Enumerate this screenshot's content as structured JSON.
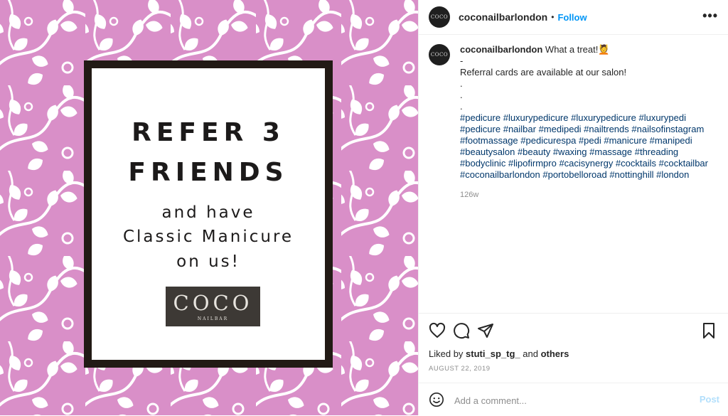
{
  "image": {
    "background_color": "#d98fc8",
    "headline_line1": "REFER 3",
    "headline_line2": "FRIENDS",
    "body_line1": "and have",
    "body_line2": "Classic Manicure",
    "body_line3": "on us!",
    "logo_main": "COCO",
    "logo_sub": "NAILBAR"
  },
  "header": {
    "avatar_text": "COCO",
    "username": "coconailbarlondon",
    "separator": "•",
    "follow_label": "Follow",
    "more_label": "•••"
  },
  "caption": {
    "avatar_text": "COCO",
    "username": "coconailbarlondon",
    "text": "What a treat!💆",
    "dash": "-",
    "line2": "Referral cards are available at our salon!",
    "dot1": ".",
    "dot2": ".",
    "dot3": ".",
    "hashtags": "#pedicure #luxurypedicure #luxurypedicure #luxurypedi #pedicure #nailbar #medipedi #nailtrends #nailsofinstagram #footmassage #pedicurespa #pedi #manicure #manipedi #beautysalon #beauty #waxing #massage #threading #bodyclinic #lipofirmpro #cacisynergy #cocktails #cocktailbar #coconailbarlondon #portobelloroad #nottinghill #london",
    "time": "126w"
  },
  "likes": {
    "prefix": "Liked by",
    "user": "stuti_sp_tg_",
    "and": "and",
    "others": "others"
  },
  "date": "AUGUST 22, 2019",
  "comment": {
    "placeholder": "Add a comment...",
    "post_label": "Post"
  },
  "colors": {
    "link": "#0095f6",
    "hashtag": "#00376b",
    "post_disabled": "#b2dffc"
  }
}
